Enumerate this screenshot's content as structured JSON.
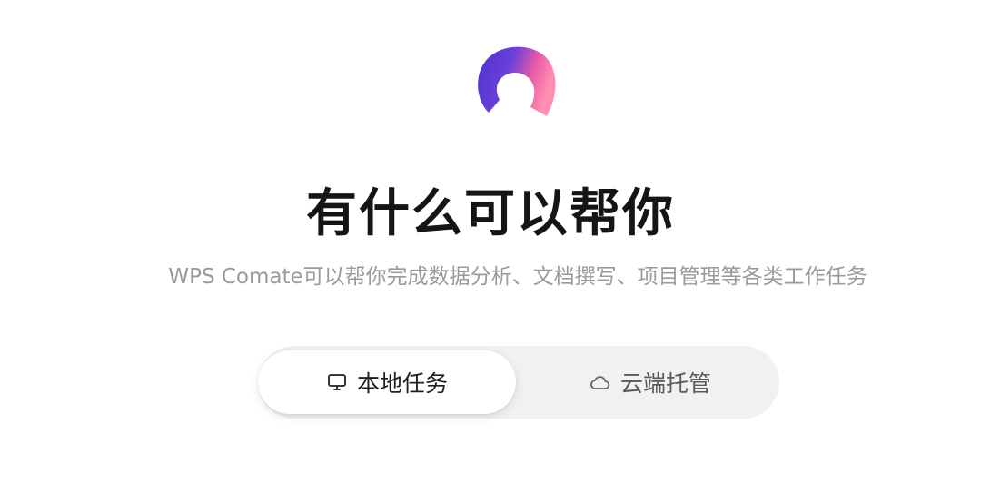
{
  "header": {
    "title": "有什么可以帮你",
    "subtitle": "WPS Comate可以帮你完成数据分析、文档撰写、项目管理等各类工作任务"
  },
  "mode_toggle": {
    "options": [
      {
        "label": "本地任务",
        "icon": "monitor-icon",
        "selected": true
      },
      {
        "label": "云端托管",
        "icon": "cloud-icon",
        "selected": false
      }
    ]
  },
  "colors": {
    "logo_purple": "#5b3fd6",
    "logo_pink": "#f06aa5",
    "title": "#151515",
    "subtitle": "#9a9a9a",
    "toggle_bg": "#f1f1f1"
  }
}
